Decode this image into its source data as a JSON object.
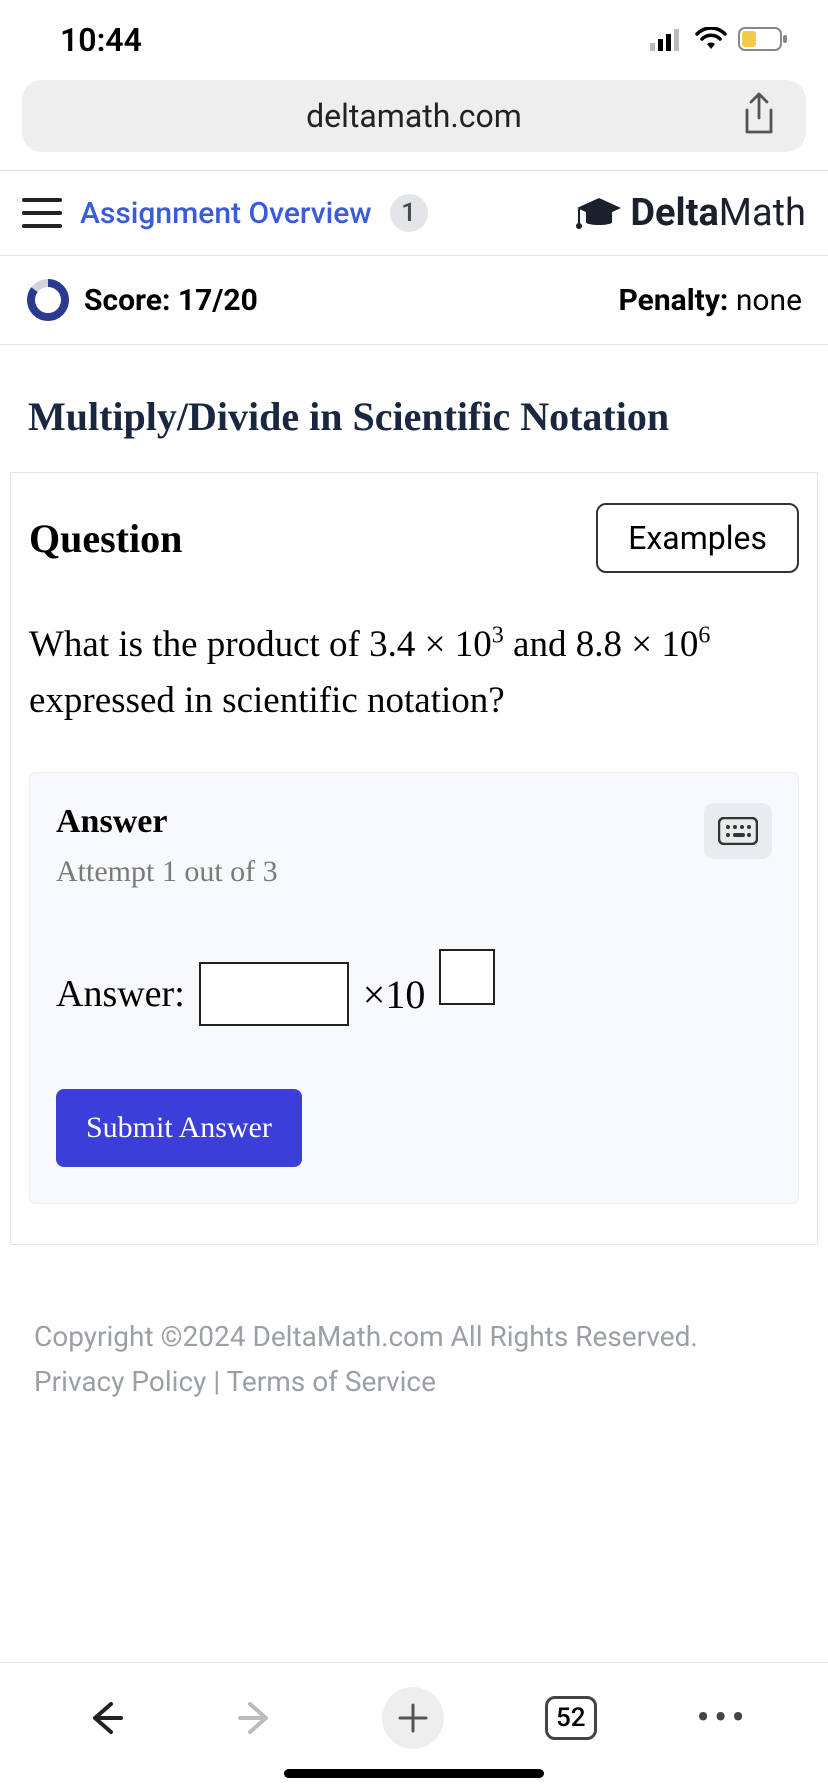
{
  "status": {
    "time": "10:44"
  },
  "browser": {
    "url": "deltamath.com",
    "tab_count": "52"
  },
  "header": {
    "overview_label": "Assignment Overview",
    "overview_badge": "1",
    "brand_bold": "Delta",
    "brand_light": "Math"
  },
  "score": {
    "label": "Score: 17/20",
    "current": 17,
    "total": 20,
    "penalty_label": "Penalty: ",
    "penalty_value": "none"
  },
  "topic": "Multiply/Divide in Scientific Notation",
  "question": {
    "heading": "Question",
    "examples_label": "Examples",
    "prompt_prefix": "What is the product of ",
    "val1_coef": "3.4",
    "val1_exp": "3",
    "mid": " and ",
    "val2_coef": "8.8",
    "val2_exp": "6",
    "prompt_suffix": " expressed in scientific notation?"
  },
  "answer": {
    "heading": "Answer",
    "attempt": "Attempt 1 out of 3",
    "label": "Answer:",
    "times": "×10",
    "submit": "Submit Answer"
  },
  "footer": {
    "copyright": "Copyright ©2024 DeltaMath.com All Rights Reserved.",
    "privacy": "Privacy Policy",
    "sep": " | ",
    "terms": "Terms of Service"
  }
}
